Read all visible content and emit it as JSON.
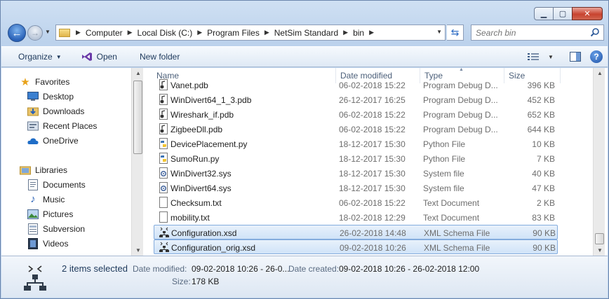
{
  "navbar": {
    "breadcrumbs": [
      "Computer",
      "Local Disk (C:)",
      "Program Files",
      "NetSim Standard",
      "bin"
    ],
    "search_placeholder": "Search bin"
  },
  "toolbar": {
    "organize_label": "Organize",
    "open_label": "Open",
    "new_folder_label": "New folder"
  },
  "sidebar": {
    "favorites_label": "Favorites",
    "favorites": [
      "Desktop",
      "Downloads",
      "Recent Places",
      "OneDrive"
    ],
    "libraries_label": "Libraries",
    "libraries": [
      "Documents",
      "Music",
      "Pictures",
      "Subversion",
      "Videos"
    ]
  },
  "columns": {
    "name": "Name",
    "date_modified": "Date modified",
    "type": "Type",
    "size": "Size"
  },
  "files": [
    {
      "name": "Vanet.pdb",
      "date": "06-02-2018 15:22",
      "type": "Program Debug D...",
      "size": "396 KB",
      "icon": "pdb-file-icon",
      "selected": false
    },
    {
      "name": "WinDivert64_1_3.pdb",
      "date": "26-12-2017 16:25",
      "type": "Program Debug D...",
      "size": "452 KB",
      "icon": "pdb-file-icon",
      "selected": false
    },
    {
      "name": "Wireshark_if.pdb",
      "date": "06-02-2018 15:22",
      "type": "Program Debug D...",
      "size": "652 KB",
      "icon": "pdb-file-icon",
      "selected": false
    },
    {
      "name": "ZigbeeDll.pdb",
      "date": "06-02-2018 15:22",
      "type": "Program Debug D...",
      "size": "644 KB",
      "icon": "pdb-file-icon",
      "selected": false
    },
    {
      "name": "DevicePlacement.py",
      "date": "18-12-2017 15:30",
      "type": "Python File",
      "size": "10 KB",
      "icon": "python-file-icon",
      "selected": false
    },
    {
      "name": "SumoRun.py",
      "date": "18-12-2017 15:30",
      "type": "Python File",
      "size": "7 KB",
      "icon": "python-file-icon",
      "selected": false
    },
    {
      "name": "WinDivert32.sys",
      "date": "18-12-2017 15:30",
      "type": "System file",
      "size": "40 KB",
      "icon": "system-file-icon",
      "selected": false
    },
    {
      "name": "WinDivert64.sys",
      "date": "18-12-2017 15:30",
      "type": "System file",
      "size": "47 KB",
      "icon": "system-file-icon",
      "selected": false
    },
    {
      "name": "Checksum.txt",
      "date": "06-02-2018 15:22",
      "type": "Text Document",
      "size": "2 KB",
      "icon": "text-file-icon",
      "selected": false
    },
    {
      "name": "mobility.txt",
      "date": "18-02-2018 12:29",
      "type": "Text Document",
      "size": "83 KB",
      "icon": "text-file-icon",
      "selected": false
    },
    {
      "name": "Configuration.xsd",
      "date": "26-02-2018 14:48",
      "type": "XML Schema File",
      "size": "90 KB",
      "icon": "xml-schema-file-icon",
      "selected": true
    },
    {
      "name": "Configuration_orig.xsd",
      "date": "09-02-2018 10:26",
      "type": "XML Schema File",
      "size": "90 KB",
      "icon": "xml-schema-file-icon",
      "selected": true
    }
  ],
  "details": {
    "selection_text": "2 items selected",
    "date_modified_label": "Date modified:",
    "date_modified_value": "09-02-2018 10:26 - 26-0...",
    "date_created_label": "Date created:",
    "date_created_value": "09-02-2018 10:26 - 26-02-2018 12:00",
    "size_label": "Size:",
    "size_value": "178 KB"
  },
  "colors": {
    "selection_fill": "#d0e3f8",
    "selection_border": "#84acdd",
    "accent_blue": "#1e395b"
  }
}
